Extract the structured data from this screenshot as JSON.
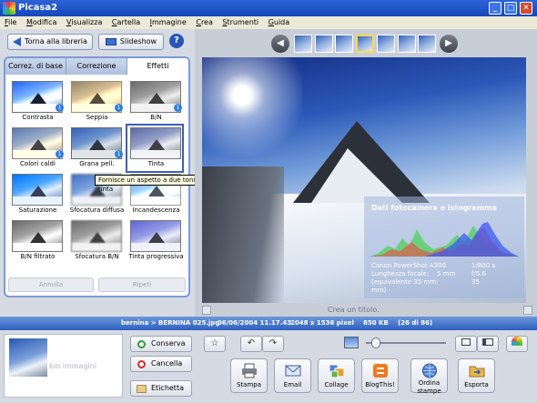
{
  "window": {
    "title": "Picasa2"
  },
  "menu": [
    "File",
    "Modifica",
    "Visualizza",
    "Cartella",
    "Immagine",
    "Crea",
    "Strumenti",
    "Guida"
  ],
  "toolbar": {
    "back_label": "Torna alla libreria",
    "slideshow_label": "Slideshow",
    "help_glyph": "?"
  },
  "tabs": [
    {
      "label": "Correz. di base",
      "active": false
    },
    {
      "label": "Correzione",
      "active": false
    },
    {
      "label": "Effetti",
      "active": true
    }
  ],
  "effects": [
    {
      "label": "Contrasta",
      "badge": "1"
    },
    {
      "label": "Seppia",
      "badge": "1"
    },
    {
      "label": "B/N",
      "badge": "1"
    },
    {
      "label": "Colori caldi",
      "badge": "1"
    },
    {
      "label": "Grana pell.",
      "badge": "1"
    },
    {
      "label": "Tinta",
      "badge": ""
    },
    {
      "label": "Saturazione",
      "badge": ""
    },
    {
      "label": "Sfocatura diffusa",
      "badge": ""
    },
    {
      "label": "Incandescenza",
      "badge": ""
    },
    {
      "label": "B/N filtrato",
      "badge": ""
    },
    {
      "label": "Sfocatura B/N",
      "badge": ""
    },
    {
      "label": "Tinta progressiva",
      "badge": ""
    }
  ],
  "tooltip": "Fornisce un aspetto a due toni o in tinta",
  "edit_buttons": {
    "undo_label": "Annulla",
    "redo_label": "Ripeti"
  },
  "nav": {
    "prev_glyph": "◀",
    "next_glyph": "▶"
  },
  "camera_info": {
    "title": "Dati fotocamera e istogramma",
    "model": "Canon PowerShot A300",
    "shutter": "1/800 s",
    "focal_label": "Lunghezza focale:",
    "focal_value": "5 mm",
    "aperture": "f/5.6",
    "equiv_line1": "(equivalente 35 mm:",
    "equiv_value": "35",
    "equiv_line2": "mm)"
  },
  "caption_placeholder": "Crea un titolo.",
  "status": {
    "filename": "bernina > BERNINA 025.jpg",
    "datetime": "06/06/2004 11.17.43",
    "dimensions": "2048 x 1536 pixel",
    "size": "850 KB",
    "position": "(26 di 86)"
  },
  "tray": {
    "label": "bio immagini"
  },
  "actions": {
    "keep_label": "Conserva",
    "delete_label": "Cancella",
    "label_label": "Etichetta"
  },
  "output_buttons": [
    "Stampa",
    "Email",
    "Collage",
    "BlogThis!",
    "Ordina stampe",
    "Esporta"
  ],
  "zoom_level": 0.1
}
